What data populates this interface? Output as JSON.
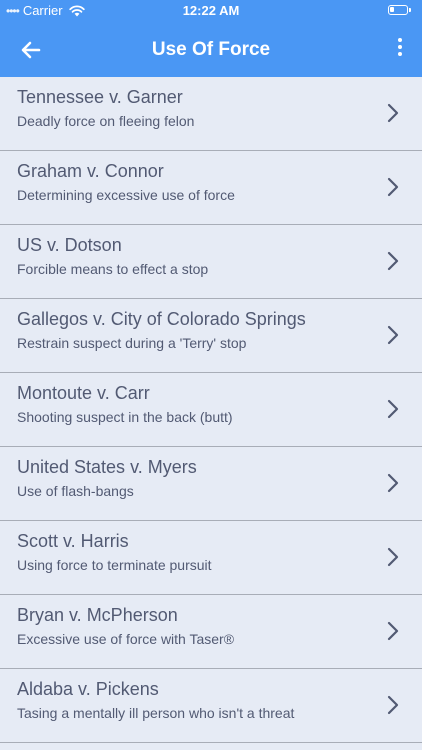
{
  "status_bar": {
    "signal_dots": "••••",
    "carrier": "Carrier",
    "time": "12:22 AM"
  },
  "header": {
    "title": "Use Of Force",
    "back_icon": "arrow-left-icon",
    "menu_icon": "more-vertical-icon"
  },
  "colors": {
    "header_bg": "#4a97f4",
    "list_bg": "#e6ebf5",
    "text": "#525a73",
    "divider": "#a8adb7"
  },
  "cases": [
    {
      "title": "Tennessee v. Garner",
      "subtitle": "Deadly force on fleeing felon"
    },
    {
      "title": "Graham v. Connor",
      "subtitle": "Determining excessive use of force"
    },
    {
      "title": "US v. Dotson",
      "subtitle": "Forcible means to effect a stop"
    },
    {
      "title": "Gallegos v. City of Colorado Springs",
      "subtitle": "Restrain suspect during a 'Terry' stop"
    },
    {
      "title": "Montoute v. Carr",
      "subtitle": "Shooting suspect in the back (butt)"
    },
    {
      "title": "United States v. Myers",
      "subtitle": "Use of flash-bangs"
    },
    {
      "title": "Scott v. Harris",
      "subtitle": "Using force to terminate pursuit"
    },
    {
      "title": "Bryan v. McPherson",
      "subtitle": "Excessive use of force with Taser®"
    },
    {
      "title": "Aldaba v. Pickens",
      "subtitle": "Tasing a mentally ill person who isn't a threat"
    }
  ]
}
